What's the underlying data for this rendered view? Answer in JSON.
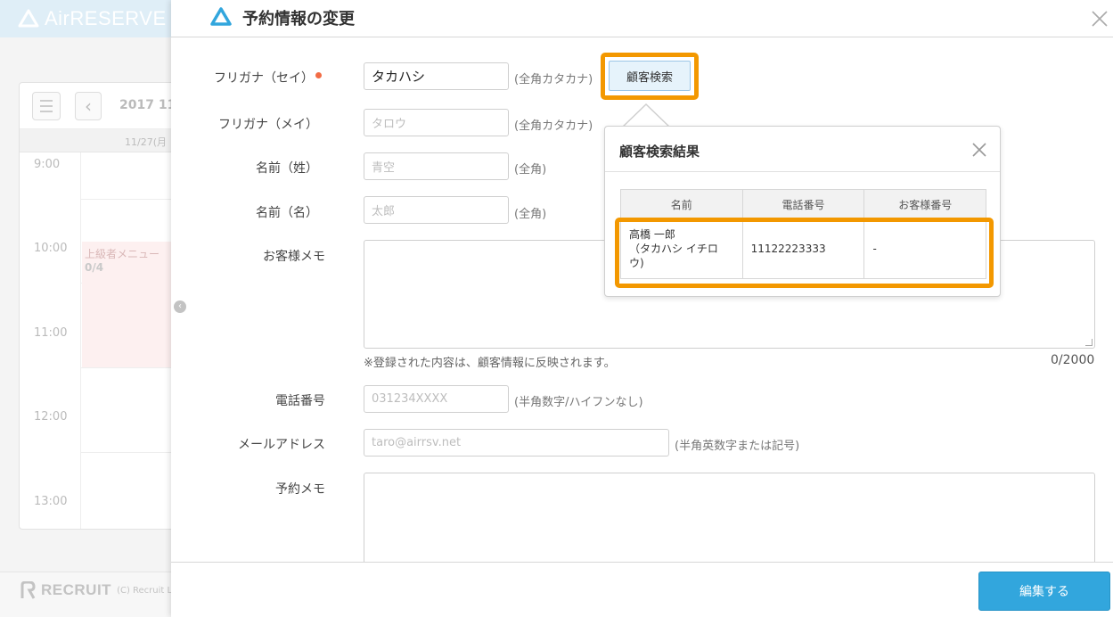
{
  "background": {
    "logo_text": "AirRESERVE",
    "menu_icon": "hamburger-icon",
    "prev_icon": "chevron-left-icon",
    "date_label": "2017 11",
    "day_header": "11/27(月",
    "times": [
      "9:00",
      "10:00",
      "11:00",
      "12:00",
      "13:00"
    ],
    "event": {
      "title": "上級者メニュー",
      "count": "0/4"
    },
    "footer_brand": "RECRUIT",
    "footer_copyright": "(C) Recruit L"
  },
  "panel": {
    "title": "予約情報の変更",
    "title_icon": "airreserve-triangle-icon",
    "close_icon": "close-icon",
    "colors": {
      "accent": "#32a6dd",
      "highlight": "#f39800",
      "required": "#f26c45"
    }
  },
  "form": {
    "furigana_sei": {
      "label": "フリガナ（セイ）",
      "value": "タカハシ",
      "hint": "(全角カタカナ)"
    },
    "search_button": "顧客検索",
    "furigana_mei": {
      "label": "フリガナ（メイ）",
      "placeholder": "タロウ",
      "hint": "(全角カタカナ)"
    },
    "last_name": {
      "label": "名前（姓）",
      "placeholder": "青空",
      "hint": "(全角)"
    },
    "first_name": {
      "label": "名前（名）",
      "placeholder": "太郎",
      "hint": "(全角)"
    },
    "customer_memo": {
      "label": "お客様メモ",
      "note": "※登録された内容は、顧客情報に反映されます。",
      "counter": "0/2000"
    },
    "phone": {
      "label": "電話番号",
      "placeholder": "031234XXXX",
      "hint": "(半角数字/ハイフンなし)"
    },
    "email": {
      "label": "メールアドレス",
      "placeholder": "taro@airrsv.net",
      "hint": "(半角英数字または記号)"
    },
    "reservation_memo": {
      "label": "予約メモ"
    }
  },
  "popover": {
    "title": "顧客検索結果",
    "columns": [
      "名前",
      "電話番号",
      "お客様番号"
    ],
    "rows": [
      {
        "name_line1": "高橋 一郎",
        "name_line2": "（タカハシ イチロ",
        "name_line3": "ウ)",
        "phone": "11122223333",
        "customer_no": "-"
      }
    ]
  },
  "footer": {
    "submit": "編集する"
  }
}
